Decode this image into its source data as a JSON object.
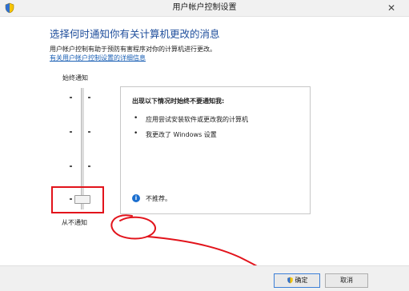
{
  "window": {
    "title": "用户帐户控制设置",
    "close_glyph": "✕",
    "icon": "uac-shield-icon"
  },
  "main": {
    "heading": "选择何时通知你有关计算机更改的消息",
    "description": "用户帐户控制有助于预防有害程序对你的计算机进行更改。",
    "link": "有关用户帐户控制设置的详细信息"
  },
  "slider": {
    "top_label": "始终通知",
    "bottom_label": "从不通知",
    "selected_level": 1,
    "level_count": 4
  },
  "panel": {
    "title": "出现以下情况时始终不要通知我:",
    "bullets": [
      "应用尝试安装软件或更改我的计算机",
      "我更改了 Windows 设置"
    ],
    "info_glyph": "i",
    "info_text": "不推荐。"
  },
  "footer": {
    "ok_label": "确定",
    "cancel_label": "取消"
  },
  "colors": {
    "heading": "#1f4e9c",
    "link": "#1a5fb4",
    "annotation_red": "#e2131b"
  }
}
